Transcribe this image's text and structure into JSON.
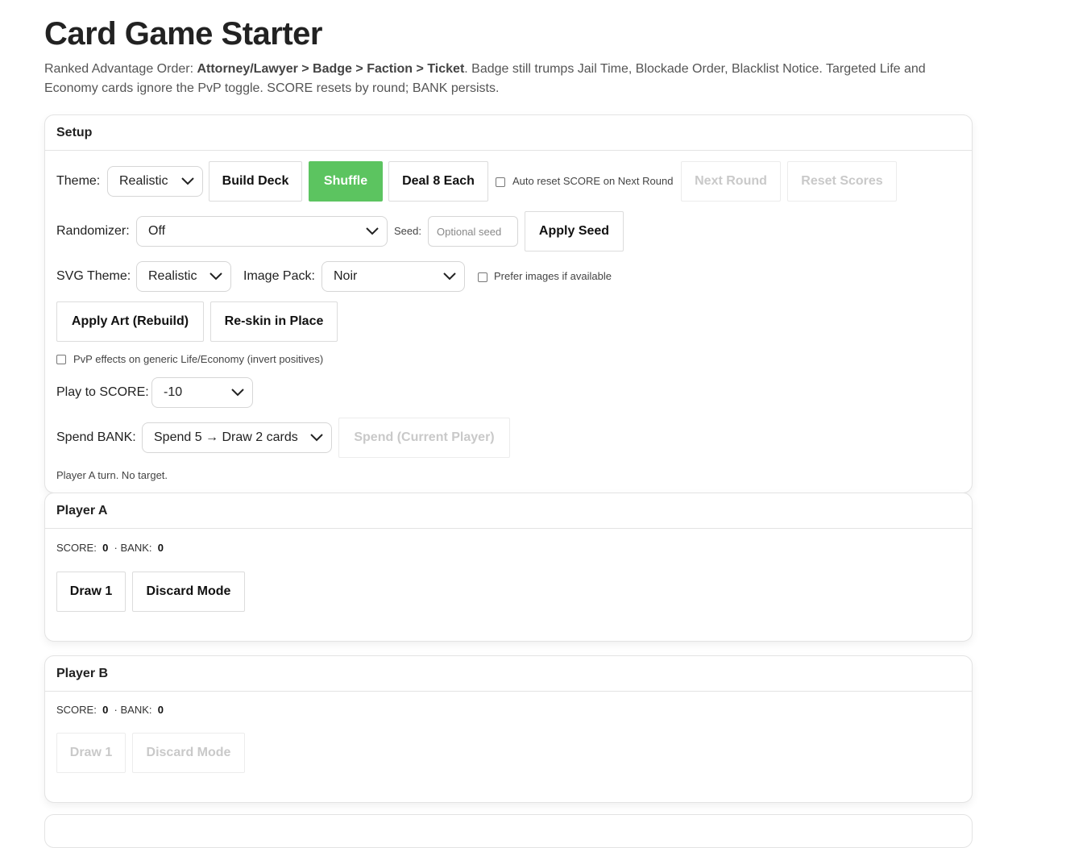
{
  "page": {
    "title": "Card Game Starter",
    "intro": {
      "prefix": "Ranked Advantage Order: ",
      "order": "Attorney/Lawyer > Badge > Faction > Ticket",
      "suffix": ". Badge still trumps Jail Time, Blockade Order, Blacklist Notice. Targeted Life and Economy cards ignore the PvP toggle. SCORE resets by round; BANK persists."
    }
  },
  "setup": {
    "heading": "Setup",
    "theme_label": "Theme:",
    "theme_value": "Realistic",
    "build_deck": "Build Deck",
    "shuffle": "Shuffle",
    "deal": "Deal 8 Each",
    "auto_reset_label": "Auto reset SCORE on Next Round",
    "next_round": "Next Round",
    "reset_scores": "Reset Scores",
    "randomizer_label": "Randomizer:",
    "randomizer_value": "Off",
    "seed_label": "Seed:",
    "seed_placeholder": "Optional seed",
    "apply_seed": "Apply Seed",
    "svg_theme_label": "SVG Theme:",
    "svg_theme_value": "Realistic",
    "image_pack_label": "Image Pack:",
    "image_pack_value": "Noir",
    "prefer_images_label": "Prefer images if available",
    "apply_art": "Apply Art (Rebuild)",
    "reskin": "Re-skin in Place",
    "pvp_label": "PvP effects on generic Life/Economy (invert positives)",
    "play_to_label": "Play to SCORE:",
    "play_to_value": "-10",
    "spend_bank_label": "Spend BANK:",
    "spend_bank_value": "Spend 5 → Draw 2 cards",
    "spend_current": "Spend (Current Player)",
    "status": "Player A turn. No target."
  },
  "players": [
    {
      "heading": "Player A",
      "score_label": "SCORE:",
      "score": "0",
      "bank_label": "· BANK:",
      "bank": "0",
      "draw": "Draw 1",
      "discard": "Discard Mode"
    },
    {
      "heading": "Player B",
      "score_label": "SCORE:",
      "score": "0",
      "bank_label": "· BANK:",
      "bank": "0",
      "draw": "Draw 1",
      "discard": "Discard Mode"
    }
  ],
  "icons": {
    "dropdown": "chevron-down-icon"
  },
  "colors": {
    "primary": "#5cc460",
    "disabled_text": "#c9c9c9"
  }
}
